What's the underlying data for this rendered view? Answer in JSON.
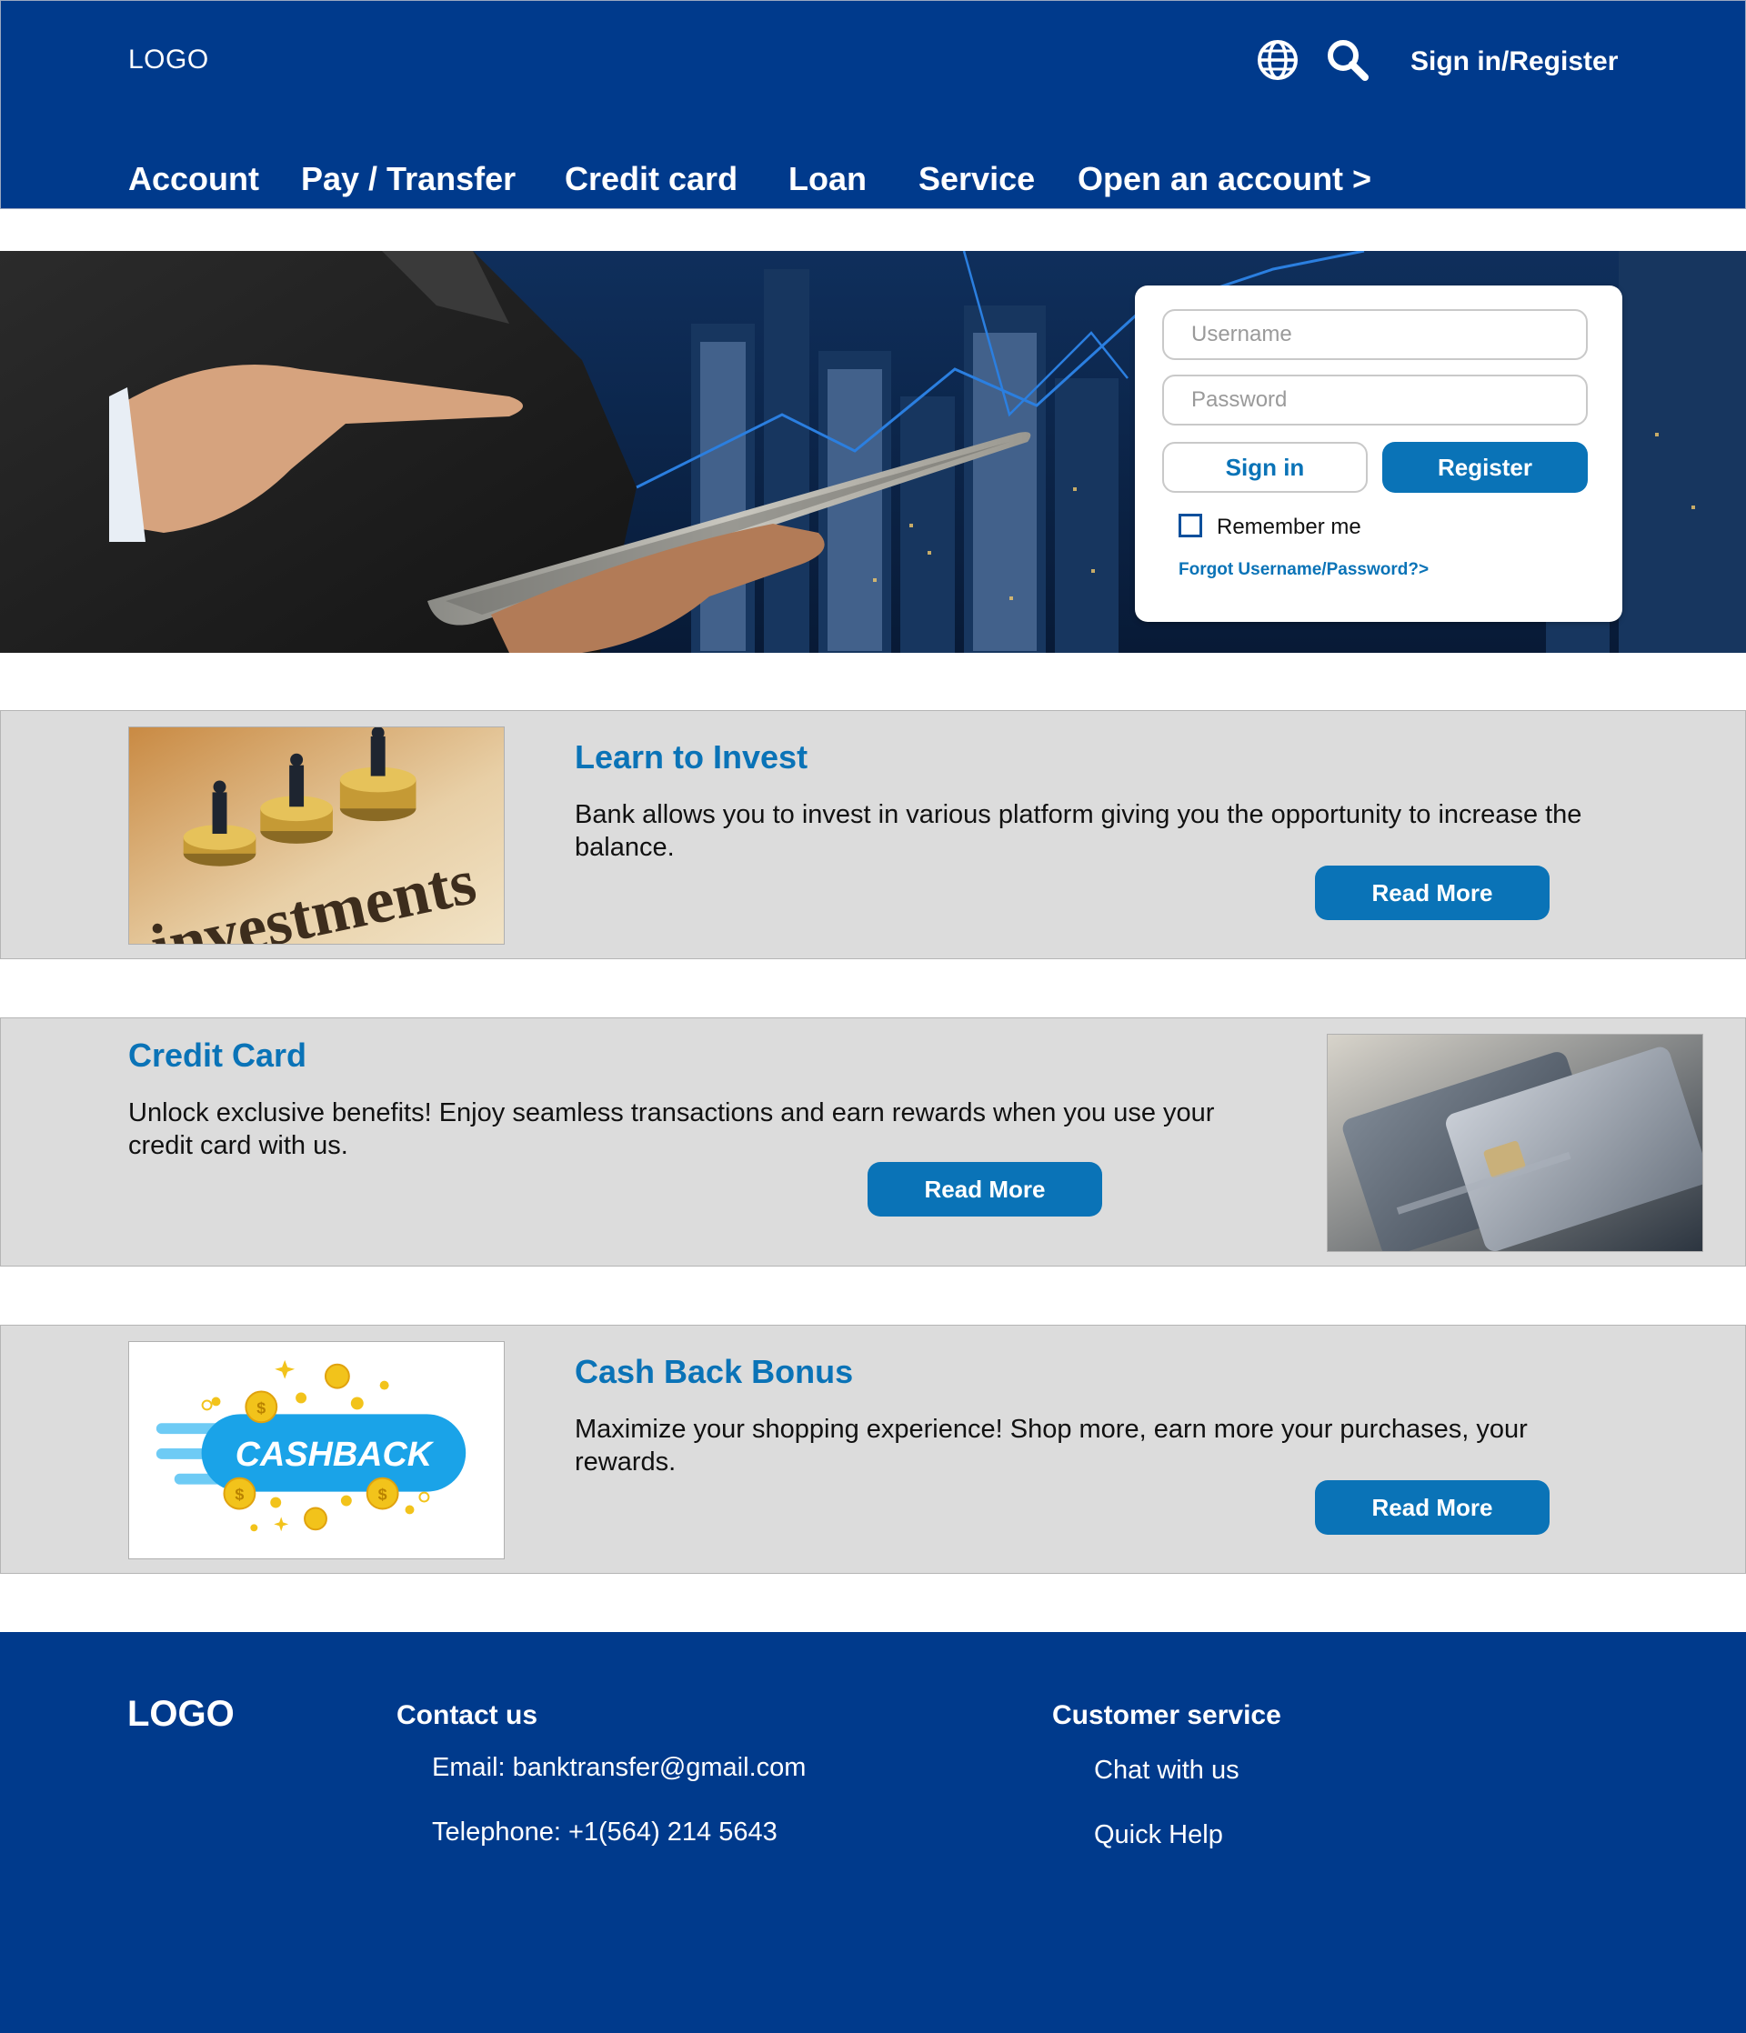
{
  "header": {
    "logo": "LOGO",
    "sign_in_register": "Sign in/Register",
    "icons": [
      "globe-icon",
      "search-icon"
    ],
    "nav": [
      {
        "label": "Account"
      },
      {
        "label": "Pay / Transfer"
      },
      {
        "label": "Credit card"
      },
      {
        "label": "Loan"
      },
      {
        "label": "Service"
      },
      {
        "label": "Open an account >"
      }
    ]
  },
  "login": {
    "username_placeholder": "Username",
    "password_placeholder": "Password",
    "sign_in_label": "Sign in",
    "register_label": "Register",
    "remember_label": "Remember me",
    "remember_checked": false,
    "forgot_label": "Forgot Username/Password?>"
  },
  "promos": [
    {
      "title": "Learn to Invest",
      "text": "Bank allows you to invest in various platform giving you the opportunity to increase the balance.",
      "button": "Read More",
      "image": "investments"
    },
    {
      "title": "Credit Card",
      "text": "Unlock exclusive benefits! Enjoy seamless transactions and earn rewards when you use your credit card with us.",
      "button": "Read More",
      "image": "credit-cards"
    },
    {
      "title": "Cash Back Bonus",
      "text": "Maximize your shopping experience! Shop more, earn more your purchases, your rewards.",
      "button": "Read More",
      "image": "cashback",
      "image_text": "CASHBACK"
    }
  ],
  "footer": {
    "logo": "LOGO",
    "contact": {
      "heading": "Contact us",
      "email": "Email: banktransfer@gmail.com",
      "phone": "Telephone: +1(564) 214 5643"
    },
    "customer_service": {
      "heading": "Customer service",
      "links": [
        "Chat with us",
        "Quick Help"
      ]
    }
  },
  "colors": {
    "brand_navy": "#003a8c",
    "accent_blue": "#0a73b7",
    "section_gray": "#dcdcdc",
    "coin_gold": "#f2c31b",
    "cashback_blue": "#1aa3e8"
  }
}
